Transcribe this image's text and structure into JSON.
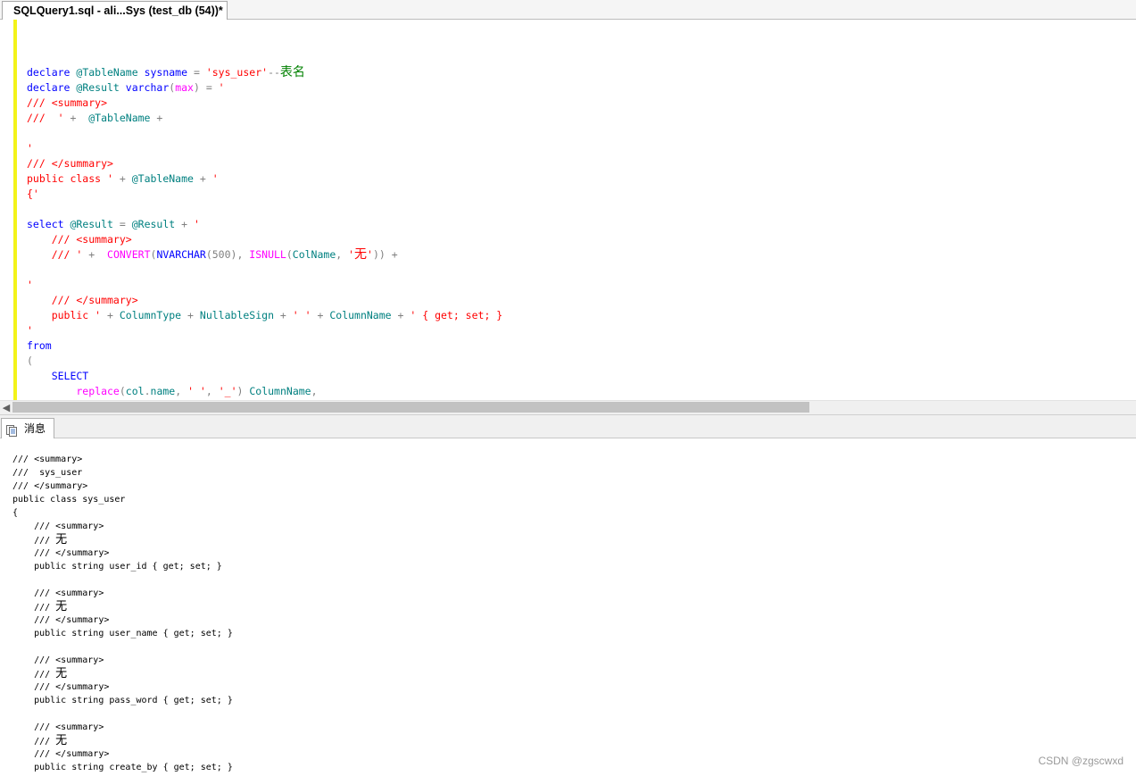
{
  "tab": {
    "title": "SQLQuery1.sql - ali...Sys (test_db (54))*"
  },
  "editor": {
    "lines": [
      [],
      [],
      [],
      [
        [
          "kw",
          "declare "
        ],
        [
          "var",
          "@TableName "
        ],
        [
          "kw",
          "sysname "
        ],
        [
          "op",
          "= "
        ],
        [
          "str",
          "'sys_user'"
        ],
        [
          "op",
          "--"
        ],
        [
          "cm",
          "表名"
        ]
      ],
      [
        [
          "kw",
          "declare "
        ],
        [
          "var",
          "@Result "
        ],
        [
          "kw",
          "varchar"
        ],
        [
          "op",
          "("
        ],
        [
          "fn",
          "max"
        ],
        [
          "op",
          ") = "
        ],
        [
          "str",
          "'"
        ]
      ],
      [
        [
          "str",
          "/// <summary>"
        ]
      ],
      [
        [
          "str",
          "///  ' "
        ],
        [
          "op",
          "+  "
        ],
        [
          "var",
          "@TableName "
        ],
        [
          "op",
          "+"
        ]
      ],
      [],
      [
        [
          "str",
          "'"
        ]
      ],
      [
        [
          "str",
          "/// </summary>"
        ]
      ],
      [
        [
          "str",
          "public class ' "
        ],
        [
          "op",
          "+ "
        ],
        [
          "var",
          "@TableName "
        ],
        [
          "op",
          "+ "
        ],
        [
          "str",
          "'"
        ]
      ],
      [
        [
          "str",
          "{'"
        ]
      ],
      [],
      [
        [
          "kw",
          "select "
        ],
        [
          "var",
          "@Result "
        ],
        [
          "op",
          "= "
        ],
        [
          "var",
          "@Result "
        ],
        [
          "op",
          "+ "
        ],
        [
          "str",
          "'"
        ]
      ],
      [
        [
          "str",
          "    /// <summary>"
        ]
      ],
      [
        [
          "str",
          "    /// ' "
        ],
        [
          "op",
          "+  "
        ],
        [
          "fn",
          "CONVERT"
        ],
        [
          "op",
          "("
        ],
        [
          "kw",
          "NVARCHAR"
        ],
        [
          "op",
          "(500), "
        ],
        [
          "fn",
          "ISNULL"
        ],
        [
          "op",
          "("
        ],
        [
          "var",
          "ColName"
        ],
        [
          "op",
          ", "
        ],
        [
          "str",
          "'无'"
        ],
        [
          "op",
          ")) +"
        ]
      ],
      [],
      [
        [
          "str",
          "'"
        ]
      ],
      [
        [
          "str",
          "    /// </summary>"
        ]
      ],
      [
        [
          "str",
          "    public ' "
        ],
        [
          "op",
          "+ "
        ],
        [
          "var",
          "ColumnType "
        ],
        [
          "op",
          "+ "
        ],
        [
          "var",
          "NullableSign "
        ],
        [
          "op",
          "+ "
        ],
        [
          "str",
          "' ' "
        ],
        [
          "op",
          "+ "
        ],
        [
          "var",
          "ColumnName "
        ],
        [
          "op",
          "+ "
        ],
        [
          "str",
          "' { get; set; }"
        ]
      ],
      [
        [
          "str",
          "'"
        ]
      ],
      [
        [
          "kw",
          "from"
        ]
      ],
      [
        [
          "op",
          "("
        ]
      ],
      [
        [
          "kw",
          "    SELECT"
        ]
      ],
      [
        [
          "fn",
          "        replace"
        ],
        [
          "op",
          "("
        ],
        [
          "var",
          "col"
        ],
        [
          "op",
          "."
        ],
        [
          "var",
          "name"
        ],
        [
          "op",
          ", "
        ],
        [
          "str",
          "' '"
        ],
        [
          "op",
          ", "
        ],
        [
          "str",
          "'_'"
        ],
        [
          "op",
          ") "
        ],
        [
          "var",
          "ColumnName"
        ],
        [
          "op",
          ","
        ]
      ]
    ]
  },
  "results_tab": {
    "label": "消息"
  },
  "messages": [
    "/// <summary>",
    "///  sys_user",
    "/// </summary>",
    "public class sys_user",
    "{",
    "    /// <summary>",
    "    /// 无",
    "    /// </summary>",
    "    public string user_id { get; set; }",
    "",
    "    /// <summary>",
    "    /// 无",
    "    /// </summary>",
    "    public string user_name { get; set; }",
    "",
    "    /// <summary>",
    "    /// 无",
    "    /// </summary>",
    "    public string pass_word { get; set; }",
    "",
    "    /// <summary>",
    "    /// 无",
    "    /// </summary>",
    "    public string create_by { get; set; }"
  ],
  "watermark": "CSDN @zgscwxd",
  "colors": {
    "keyword": "#0000ff",
    "string": "#ff0000",
    "variable": "#008080",
    "operator": "#808080",
    "function": "#ff00ff",
    "comment": "#008000",
    "change_marker": "#f3f31a"
  }
}
